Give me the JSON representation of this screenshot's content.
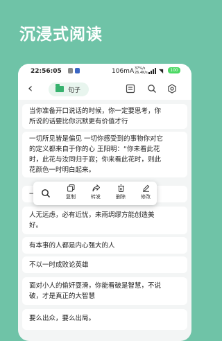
{
  "promo": {
    "title": "沉浸式阅读"
  },
  "status_bar": {
    "time": "22:56:05",
    "net_speed": "106mA",
    "rate_line1": "37%/s",
    "rate_line2": "26.4K/s",
    "battery": "100"
  },
  "app_bar": {
    "folder_label": "句子"
  },
  "quotes": [
    {
      "lines": [
        "当你准备开口说话的时候，你一定要思考，你",
        "所说的话要比你沉默更有价值才行"
      ]
    },
    {
      "lines": [
        "一切所见皆是偏见 一切你感受到的事物你对它",
        "的定义都来自于你的心 王阳明：“你未看此花",
        "时，此花与汝同归于寂；你来看此花时，则此",
        "花颜色一时明白起来。"
      ]
    },
    {
      "lines": [
        "一"
      ]
    },
    {
      "lines": [
        "人无远虑，必有近忧，未雨绸缪方能创造美",
        "好。"
      ]
    },
    {
      "lines": [
        "有本事的人都是内心强大的人"
      ]
    },
    {
      "lines": [
        "不以一时成败论英雄"
      ]
    },
    {
      "lines": [
        "面对小人的偷奸耍滑，你能看破是智慧，不说",
        "破，才是真正的大智慧"
      ]
    },
    {
      "lines": [
        "要么出众，要么出局。"
      ]
    }
  ],
  "context_menu": {
    "copy": "复制",
    "forward": "转发",
    "delete": "删除",
    "edit": "修改"
  },
  "colors": {
    "background": "#6fc3a7",
    "accent": "#37b26e"
  }
}
